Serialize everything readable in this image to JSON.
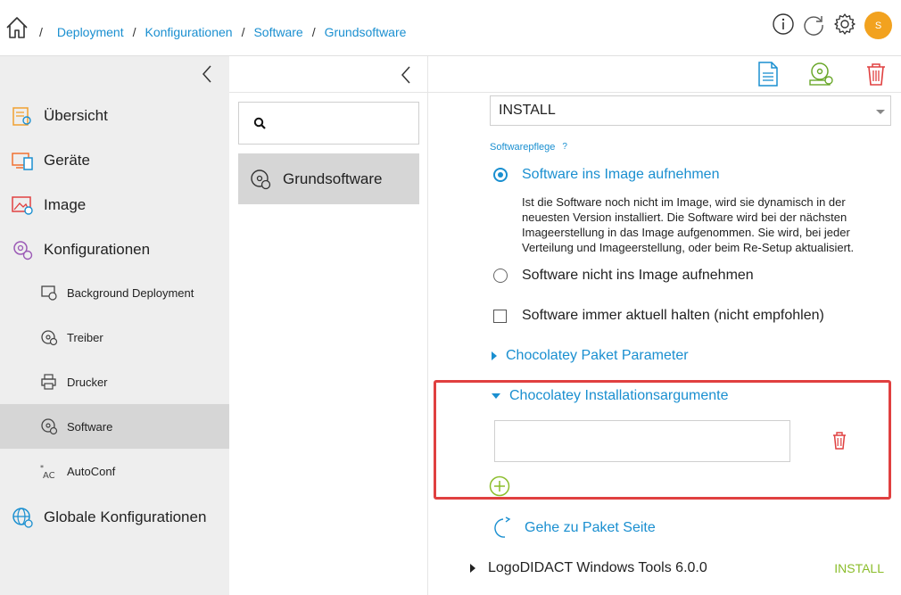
{
  "breadcrumb": {
    "items": [
      "Deployment",
      "Konfigurationen",
      "Software",
      "Grundsoftware"
    ]
  },
  "header": {
    "avatar_letter": "S",
    "info_icon": "info-icon",
    "refresh_icon": "refresh-icon",
    "settings_icon": "gear-icon"
  },
  "sidebar": {
    "items": [
      {
        "label": "Übersicht",
        "icon": "overview-icon"
      },
      {
        "label": "Geräte",
        "icon": "devices-icon"
      },
      {
        "label": "Image",
        "icon": "image-icon"
      },
      {
        "label": "Konfigurationen",
        "icon": "configurations-icon"
      },
      {
        "label": "Background Deployment",
        "icon": "background-deployment-icon"
      },
      {
        "label": "Treiber",
        "icon": "driver-icon"
      },
      {
        "label": "Drucker",
        "icon": "printer-icon"
      },
      {
        "label": "Software",
        "icon": "software-icon"
      },
      {
        "label": "AutoConf",
        "icon": "autoconf-icon"
      },
      {
        "label": "Globale Konfigurationen",
        "icon": "global-config-icon"
      }
    ],
    "active": "Software"
  },
  "middle": {
    "search_placeholder": "",
    "selected_item": "Grundsoftware"
  },
  "content": {
    "install_select": "INSTALL",
    "softwarepflege_label": "Softwarepflege",
    "help_mark": "?",
    "radio_include": "Software ins Image aufnehmen",
    "radio_include_desc": "Ist die Software noch nicht im Image, wird sie dynamisch in der neuesten Version installiert. Die Software wird bei der nächsten Imageerstellung in das Image aufgenommen. Sie wird, bei jeder Verteilung und Imageerstellung, oder beim Re-Setup aktualisiert.",
    "radio_exclude": "Software nicht ins Image aufnehmen",
    "checkbox_always_update": "Software immer aktuell halten (nicht empfohlen)",
    "chocolatey_params": "Chocolatey Paket Parameter",
    "chocolatey_args": "Chocolatey Installationsargumente",
    "chocolatey_arg_value": "",
    "goto_package": "Gehe zu Paket Seite",
    "next_package_name": "LogoDIDACT Windows Tools 6.0.0",
    "next_package_status": "INSTALL"
  },
  "colors": {
    "accent": "#1a8fd0",
    "highlight": "#e04040",
    "install_green": "#8bbd2b",
    "avatar": "#f2a21f"
  }
}
